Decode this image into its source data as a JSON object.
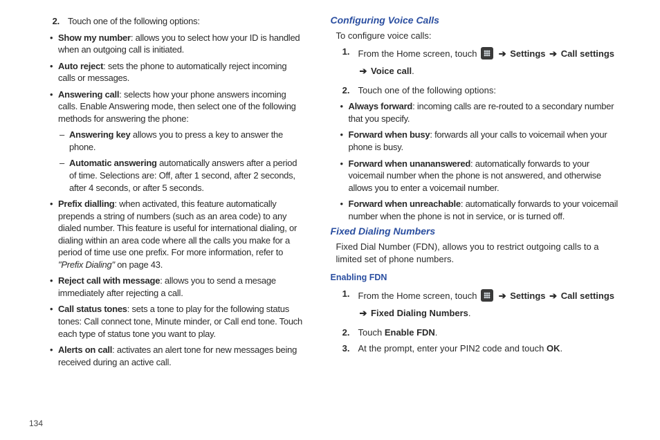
{
  "page_number": "134",
  "left": {
    "step2_intro": "Touch one of the following options:",
    "bullets": {
      "show_my_number": {
        "label": "Show my number",
        "text": ": allows you to select how your ID is handled when an outgoing call is initiated."
      },
      "auto_reject": {
        "label": "Auto reject",
        "text": ": sets the phone to automatically reject incoming calls or messages."
      },
      "answering_call": {
        "label": "Answering call",
        "text": ": selects how your phone answers incoming calls. Enable Answering mode, then select one of the following methods for answering the phone:"
      },
      "answering_key": {
        "label": "Answering key",
        "text": " allows you to press a key to answer the phone."
      },
      "auto_answering": {
        "label": "Automatic answering",
        "text": " automatically answers after a period of time. Selections are: Off, after 1 second, after 2 seconds, after 4 seconds, or after 5 seconds."
      },
      "prefix_dialling": {
        "label": "Prefix dialling",
        "text_a": ": when activated, this feature automatically prepends a string of numbers (such as an area code) to any dialed number. This feature is useful for international dialing, or dialing within an area code where all the calls you make for a period of time use one prefix. For more information, refer to ",
        "ref_i": "\"Prefix Dialing\"",
        "text_b": "  on page 43."
      },
      "reject_call_msg": {
        "label": "Reject call with message",
        "text": ": allows you to send a mesage immediately after rejecting a call."
      },
      "call_status_tones": {
        "label": "Call status tones",
        "text": ": sets a tone to play for the following status tones: Call connect tone, Minute minder, or Call end tone. Touch each type of status tone you want to play."
      },
      "alerts_on_call": {
        "label": "Alerts on call",
        "text": ": activates an alert tone for new messages being received during an active call."
      }
    }
  },
  "right": {
    "h_voice": "Configuring Voice Calls",
    "voice_intro": "To configure voice calls:",
    "voice_step1_a": "From the Home screen, touch ",
    "arrow": "➔",
    "settings": "Settings",
    "call_settings": "Call settings",
    "voice_call": "Voice call",
    "period": ".",
    "voice_step2": "Touch one of the following options:",
    "fwd": {
      "always": {
        "label": "Always forward",
        "text": ": incoming calls are re-routed to a secondary number that you specify."
      },
      "busy": {
        "label": "Forward when busy",
        "text": ": forwards all your calls to voicemail when your phone is busy."
      },
      "unanswered": {
        "label": "Forward when unananswered",
        "text": ": automatically forwards to your voicemail number when the phone is not answered, and otherwise allows you to enter a voicemail number."
      },
      "unreachable": {
        "label": "Forward when unreachable",
        "text": ": automatically forwards to your voicemail number when the phone is not in service, or is turned off."
      }
    },
    "h_fdn": "Fixed Dialing Numbers",
    "fdn_para": "Fixed Dial Number (FDN), allows you to restrict outgoing calls to a limited set of phone numbers.",
    "h_enabling_fdn": "Enabling FDN",
    "fdn1_a": "From the Home screen, touch ",
    "fixed_dialing_numbers": "Fixed Dialing Numbers",
    "fdn2_a": "Touch ",
    "fdn2_b": "Enable FDN",
    "fdn3_a": "At the prompt, enter your PIN2 code and touch ",
    "fdn3_b": "OK"
  }
}
